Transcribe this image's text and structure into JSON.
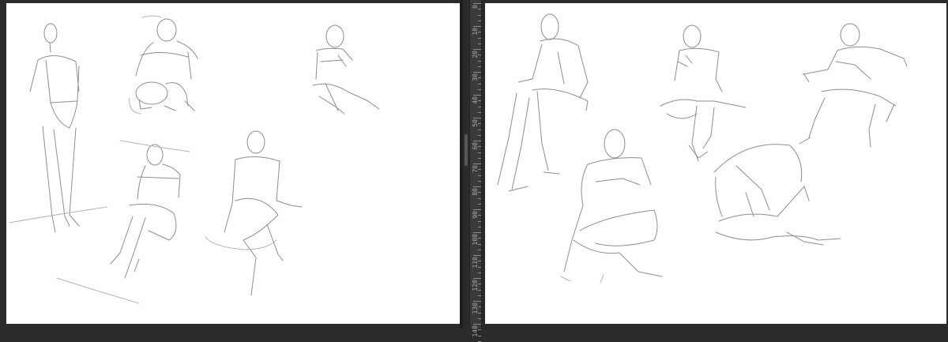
{
  "workspace": {
    "background_color": "#2b2b2b",
    "canvas_color": "#ffffff",
    "stroke_color": "#8e8e8e"
  },
  "canvases": [
    {
      "name": "left",
      "content": "gesture-sketches"
    },
    {
      "name": "right",
      "content": "gesture-sketches"
    }
  ],
  "ruler": {
    "orientation": "vertical",
    "labels": [
      "0",
      "10",
      "20",
      "30",
      "40",
      "50",
      "60",
      "70",
      "80",
      "90",
      "100",
      "110",
      "120",
      "130",
      "140"
    ]
  }
}
